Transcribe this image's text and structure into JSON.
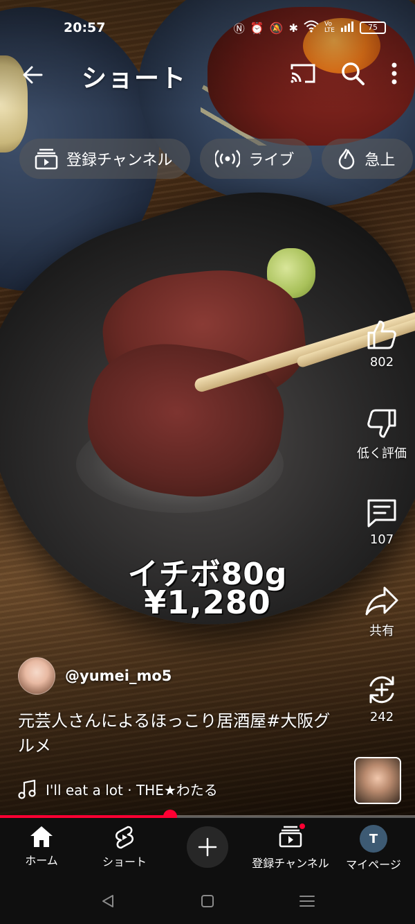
{
  "status_bar": {
    "time": "20:57",
    "battery": "75"
  },
  "header": {
    "title": "ショート"
  },
  "chips": [
    {
      "label": "登録チャンネル",
      "icon": "subscriptions-icon"
    },
    {
      "label": "ライブ",
      "icon": "live-icon"
    },
    {
      "label": "急上",
      "icon": "trending-icon"
    }
  ],
  "video": {
    "overlay_line1": "イチボ80g",
    "overlay_line2": "¥1,280",
    "channel": "@yumei_mo5",
    "caption": "元芸人さんによるほっこり居酒屋#大阪グルメ",
    "music": "I'll eat a lot · THE★わたる",
    "progress": 0.41
  },
  "actions": {
    "like_count": "802",
    "dislike_label": "低く評価",
    "comment_count": "107",
    "share_label": "共有",
    "remix_count": "242"
  },
  "bottom_nav": {
    "home": "ホーム",
    "shorts": "ショート",
    "subscriptions": "登録チャンネル",
    "mypage": "マイページ",
    "profile_initial": "T"
  },
  "colors": {
    "accent": "#ff0033",
    "nav_bg": "#0f0f0f",
    "chip_bg": "#5a5a5a"
  }
}
